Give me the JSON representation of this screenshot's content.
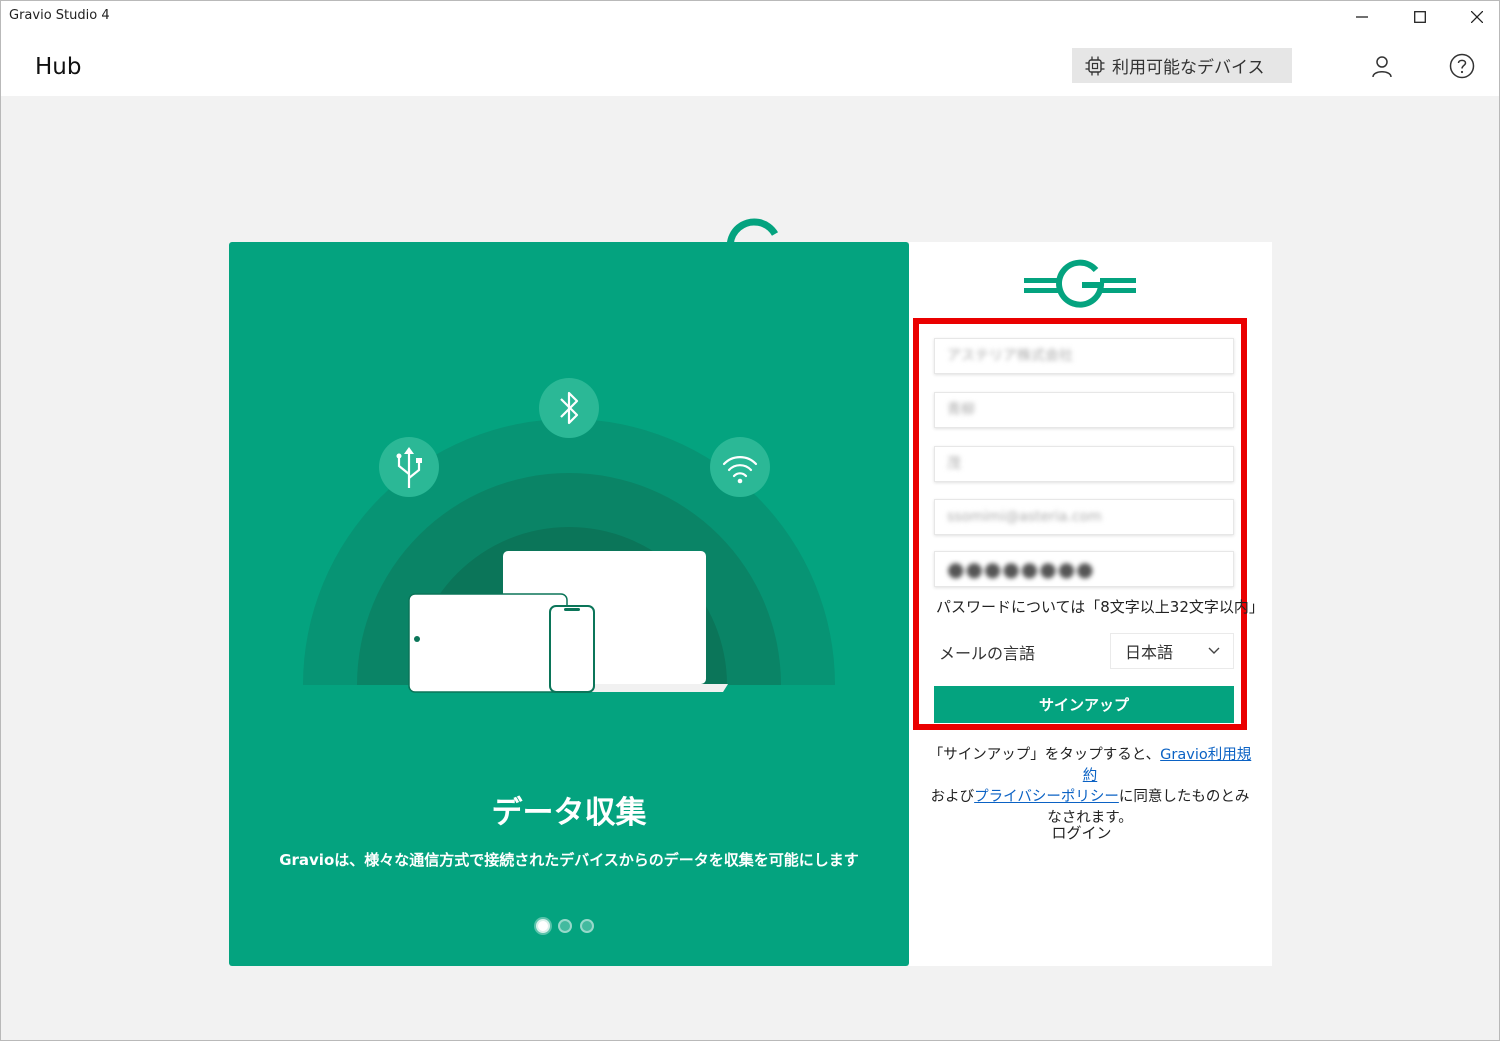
{
  "window": {
    "title": "Gravio Studio 4"
  },
  "header": {
    "title": "Hub",
    "devices_button": "利用可能なデバイス"
  },
  "hero": {
    "title": "データ収集",
    "description": "Gravioは、様々な通信方式で接続されたデバイスからのデータを収集を可能にします",
    "slides": 3,
    "active_slide": 1
  },
  "form": {
    "fields": [
      {
        "name": "company",
        "value": "アステリア株式会社"
      },
      {
        "name": "last-name",
        "value": "青柳"
      },
      {
        "name": "first-name",
        "value": "茂"
      },
      {
        "name": "email",
        "value": "ssomimi@asteria.com"
      },
      {
        "name": "password",
        "value": "●●●●●●●●"
      }
    ],
    "password_note": "パスワードについては「8文字以上32文字以内」",
    "language_label": "メールの言語",
    "language_value": "日本語",
    "signup_button": "サインアップ"
  },
  "terms": {
    "prefix": "「サインアップ」をタップすると、",
    "terms_link": "Gravio利用規約",
    "middle": "および",
    "privacy_link": "プライバシーポリシー",
    "suffix": "に同意したものとみなされます。"
  },
  "login_link": "ログイン",
  "colors": {
    "brand_green": "#04a37f",
    "highlight_red": "#ea0000",
    "link_blue": "#0b62c4"
  }
}
